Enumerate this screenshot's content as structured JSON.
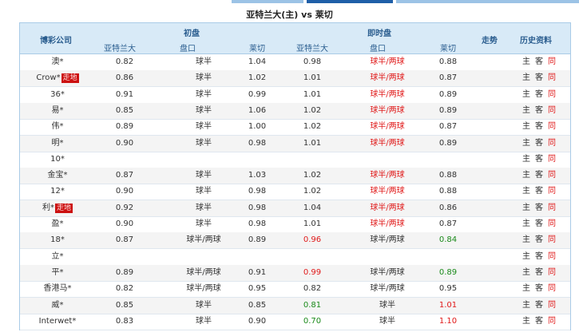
{
  "tabs": {
    "active_index": 1
  },
  "match": {
    "title": "亚特兰大(主) vs 莱切"
  },
  "header": {
    "company": "博彩公司",
    "initial": "初盘",
    "live": "即时盘",
    "trend": "走势",
    "history": "历史资料",
    "home": "亚特兰大",
    "handicap": "盘口",
    "away": "莱切"
  },
  "history_links": {
    "home": "主",
    "away": "客",
    "h2h": "同"
  },
  "colors": {
    "up": "#e01919",
    "down": "#1a8a1a",
    "header_bg": "#d8eaf7",
    "badge_bg": "#cc1111"
  },
  "rows": [
    {
      "company": "澳*",
      "badge": "",
      "i_home": "0.82",
      "i_hcp": "球半",
      "i_away": "1.04",
      "l_home": "0.98",
      "l_hcp": "球半/两球",
      "l_away": "0.88",
      "l_home_dir": "",
      "l_hcp_dir": "up",
      "l_away_dir": ""
    },
    {
      "company": "Crow*",
      "badge": "走地",
      "i_home": "0.86",
      "i_hcp": "球半",
      "i_away": "1.02",
      "l_home": "1.01",
      "l_hcp": "球半/两球",
      "l_away": "0.87",
      "l_home_dir": "",
      "l_hcp_dir": "up",
      "l_away_dir": ""
    },
    {
      "company": "36*",
      "badge": "",
      "i_home": "0.91",
      "i_hcp": "球半",
      "i_away": "0.99",
      "l_home": "1.01",
      "l_hcp": "球半/两球",
      "l_away": "0.89",
      "l_home_dir": "",
      "l_hcp_dir": "up",
      "l_away_dir": ""
    },
    {
      "company": "易*",
      "badge": "",
      "i_home": "0.85",
      "i_hcp": "球半",
      "i_away": "1.06",
      "l_home": "1.02",
      "l_hcp": "球半/两球",
      "l_away": "0.89",
      "l_home_dir": "",
      "l_hcp_dir": "up",
      "l_away_dir": ""
    },
    {
      "company": "伟*",
      "badge": "",
      "i_home": "0.89",
      "i_hcp": "球半",
      "i_away": "1.00",
      "l_home": "1.02",
      "l_hcp": "球半/两球",
      "l_away": "0.87",
      "l_home_dir": "",
      "l_hcp_dir": "up",
      "l_away_dir": ""
    },
    {
      "company": "明*",
      "badge": "",
      "i_home": "0.90",
      "i_hcp": "球半",
      "i_away": "0.98",
      "l_home": "1.01",
      "l_hcp": "球半/两球",
      "l_away": "0.89",
      "l_home_dir": "",
      "l_hcp_dir": "up",
      "l_away_dir": ""
    },
    {
      "company": "10*",
      "badge": "",
      "i_home": "",
      "i_hcp": "",
      "i_away": "",
      "l_home": "",
      "l_hcp": "",
      "l_away": "",
      "l_home_dir": "",
      "l_hcp_dir": "",
      "l_away_dir": ""
    },
    {
      "company": "金宝*",
      "badge": "",
      "i_home": "0.87",
      "i_hcp": "球半",
      "i_away": "1.03",
      "l_home": "1.02",
      "l_hcp": "球半/两球",
      "l_away": "0.88",
      "l_home_dir": "",
      "l_hcp_dir": "up",
      "l_away_dir": ""
    },
    {
      "company": "12*",
      "badge": "",
      "i_home": "0.90",
      "i_hcp": "球半",
      "i_away": "0.98",
      "l_home": "1.02",
      "l_hcp": "球半/两球",
      "l_away": "0.88",
      "l_home_dir": "",
      "l_hcp_dir": "up",
      "l_away_dir": ""
    },
    {
      "company": "利*",
      "badge": "走地",
      "i_home": "0.92",
      "i_hcp": "球半",
      "i_away": "0.98",
      "l_home": "1.04",
      "l_hcp": "球半/两球",
      "l_away": "0.86",
      "l_home_dir": "",
      "l_hcp_dir": "up",
      "l_away_dir": ""
    },
    {
      "company": "盈*",
      "badge": "",
      "i_home": "0.90",
      "i_hcp": "球半",
      "i_away": "0.98",
      "l_home": "1.01",
      "l_hcp": "球半/两球",
      "l_away": "0.87",
      "l_home_dir": "",
      "l_hcp_dir": "up",
      "l_away_dir": ""
    },
    {
      "company": "18*",
      "badge": "",
      "i_home": "0.87",
      "i_hcp": "球半/两球",
      "i_away": "0.89",
      "l_home": "0.96",
      "l_hcp": "球半/两球",
      "l_away": "0.84",
      "l_home_dir": "up",
      "l_hcp_dir": "",
      "l_away_dir": "down"
    },
    {
      "company": "立*",
      "badge": "",
      "i_home": "",
      "i_hcp": "",
      "i_away": "",
      "l_home": "",
      "l_hcp": "",
      "l_away": "",
      "l_home_dir": "",
      "l_hcp_dir": "",
      "l_away_dir": ""
    },
    {
      "company": "平*",
      "badge": "",
      "i_home": "0.89",
      "i_hcp": "球半/两球",
      "i_away": "0.91",
      "l_home": "0.99",
      "l_hcp": "球半/两球",
      "l_away": "0.89",
      "l_home_dir": "up",
      "l_hcp_dir": "",
      "l_away_dir": "down"
    },
    {
      "company": "香港马*",
      "badge": "",
      "i_home": "0.82",
      "i_hcp": "球半/两球",
      "i_away": "0.95",
      "l_home": "0.82",
      "l_hcp": "球半/两球",
      "l_away": "0.95",
      "l_home_dir": "",
      "l_hcp_dir": "",
      "l_away_dir": ""
    },
    {
      "company": "威*",
      "badge": "",
      "i_home": "0.85",
      "i_hcp": "球半",
      "i_away": "0.85",
      "l_home": "0.81",
      "l_hcp": "球半",
      "l_away": "1.01",
      "l_home_dir": "down",
      "l_hcp_dir": "",
      "l_away_dir": "up"
    },
    {
      "company": "Interwet*",
      "badge": "",
      "i_home": "0.83",
      "i_hcp": "球半",
      "i_away": "0.90",
      "l_home": "0.70",
      "l_hcp": "球半",
      "l_away": "1.10",
      "l_home_dir": "down",
      "l_hcp_dir": "",
      "l_away_dir": "up"
    }
  ]
}
